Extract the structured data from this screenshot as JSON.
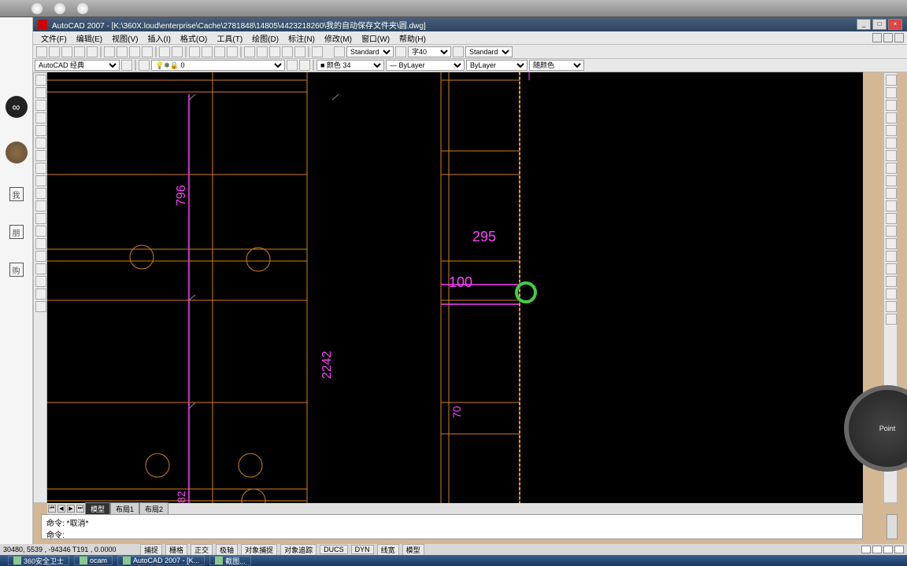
{
  "app": {
    "name": "AutoCAD 2007",
    "title_path": "[K:\\360X.loud\\enterprise\\Cache\\2781848\\14805\\4423218260\\我的自动保存文件夹\\圆.dwg]"
  },
  "menus": [
    "文件(F)",
    "编辑(E)",
    "视图(V)",
    "插入(I)",
    "格式(O)",
    "工具(T)",
    "绘图(D)",
    "标注(N)",
    "修改(M)",
    "窗口(W)",
    "帮助(H)"
  ],
  "workspace": "AutoCAD 经典",
  "toolbar2": {
    "layer": "0",
    "color": "颜色 34",
    "lineweight": "ByLayer",
    "linetype": "ByLayer",
    "plot": "随颜色"
  },
  "style_bar": {
    "text_style": "Standard",
    "dim_style": "字40",
    "table_style": "Standard"
  },
  "dims": {
    "a": "796",
    "b": "295",
    "c": "100",
    "d": "70",
    "e": "2242",
    "f": "82"
  },
  "sheet_tabs": {
    "model": "模型",
    "layout1": "布局1",
    "layout2": "布局2"
  },
  "command": {
    "line1": "命令: *取消*",
    "line2": "命令: "
  },
  "status": {
    "coord": "30480, 5539 , -94346  T191 , 0.0000",
    "buttons": [
      "捕捉",
      "栅格",
      "正交",
      "极轴",
      "对象捕捉",
      "对象追踪",
      "DUCS",
      "DYN",
      "线宽",
      "模型"
    ]
  },
  "taskbar": [
    "360安全卫士",
    "ocam",
    "AutoCAD 2007 - [K...",
    "截图..."
  ],
  "nav_wheel": "Point"
}
